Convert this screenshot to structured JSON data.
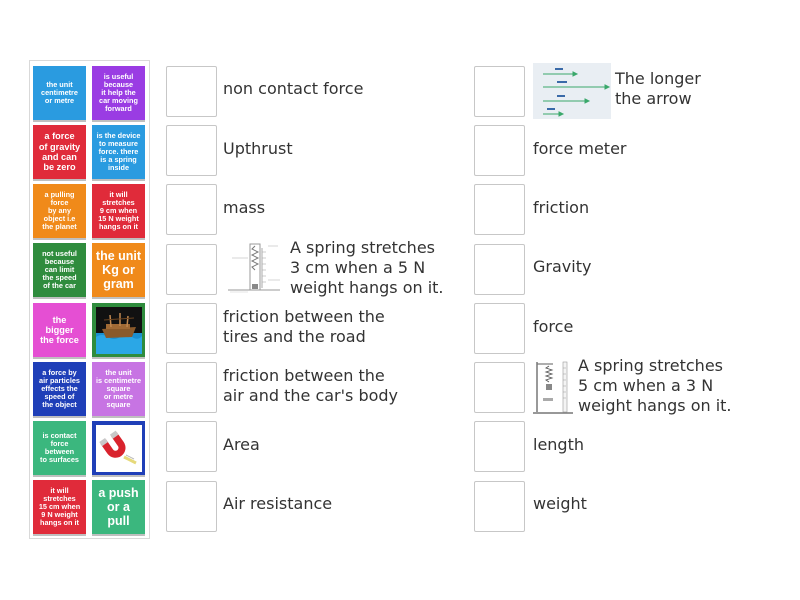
{
  "colors": {
    "blue": "#2a9be0",
    "purple": "#9a3ce3",
    "red": "#e02b3a",
    "orange": "#f08a1a",
    "dark_green": "#2f8c3d",
    "green": "#3bb77e",
    "pink": "#e54fd3",
    "navy": "#1f3fb8",
    "light_purple": "#c774e3"
  },
  "tiles": [
    {
      "text": "the unit\ncentimetre\nor metre",
      "color": "blue"
    },
    {
      "text": "is useful\nbecause\nit help the\ncar moving\nforward",
      "color": "purple"
    },
    {
      "text": "a force\nof gravity\nand can\nbe zero",
      "color": "red"
    },
    {
      "text": "is the device\nto measure\nforce. there\nis a spring\ninside",
      "color": "blue"
    },
    {
      "text": "a pulling\nforce\nby any\nobject i.e\nthe planet",
      "color": "orange"
    },
    {
      "text": "it will\nstretches\n9 cm when\n15 N weight\nhangs on it",
      "color": "red"
    },
    {
      "text": "not useful\nbecause\ncan limit\nthe speed\nof the car",
      "color": "dark_green"
    },
    {
      "text": "the unit\nKg or\ngram",
      "color": "orange"
    },
    {
      "text": "the\nbigger\nthe force",
      "color": "pink"
    },
    {
      "text": "",
      "color": "dark_green",
      "icon": "sunken-ship-image"
    },
    {
      "text": "a force by\nair particles\neffects the\nspeed of\nthe object",
      "color": "navy"
    },
    {
      "text": "the unit\nis centimetre\nsquare\nor metre\nsquare",
      "color": "light_purple"
    },
    {
      "text": "is contact\nforce\nbetween\nto surfaces",
      "color": "green"
    },
    {
      "text": "",
      "color": "navy",
      "icon": "magnet-image"
    },
    {
      "text": "it will\nstretches\n15 cm when\n9 N weight\nhangs on it",
      "color": "red"
    },
    {
      "text": "a push\nor a\npull",
      "color": "green"
    }
  ],
  "left_column": [
    {
      "label": "non contact force"
    },
    {
      "label": "Upthrust"
    },
    {
      "label": "mass"
    },
    {
      "label": "A spring stretches\n3 cm when a 5 N\nweight hangs on it.",
      "icon": "spring-scale-diagram-image"
    },
    {
      "label": "friction between the\ntires and the road"
    },
    {
      "label": "friction between the\nair and the car's body"
    },
    {
      "label": "Area"
    },
    {
      "label": "Air resistance"
    }
  ],
  "right_column": [
    {
      "label": "The longer\nthe arrow",
      "icon": "force-arrows-image"
    },
    {
      "label": "force meter"
    },
    {
      "label": "friction"
    },
    {
      "label": "Gravity"
    },
    {
      "label": "force"
    },
    {
      "label": "A spring stretches\n5 cm when a 3 N\nweight hangs on it.",
      "icon": "spring-stand-image"
    },
    {
      "label": "length"
    },
    {
      "label": "weight"
    }
  ]
}
